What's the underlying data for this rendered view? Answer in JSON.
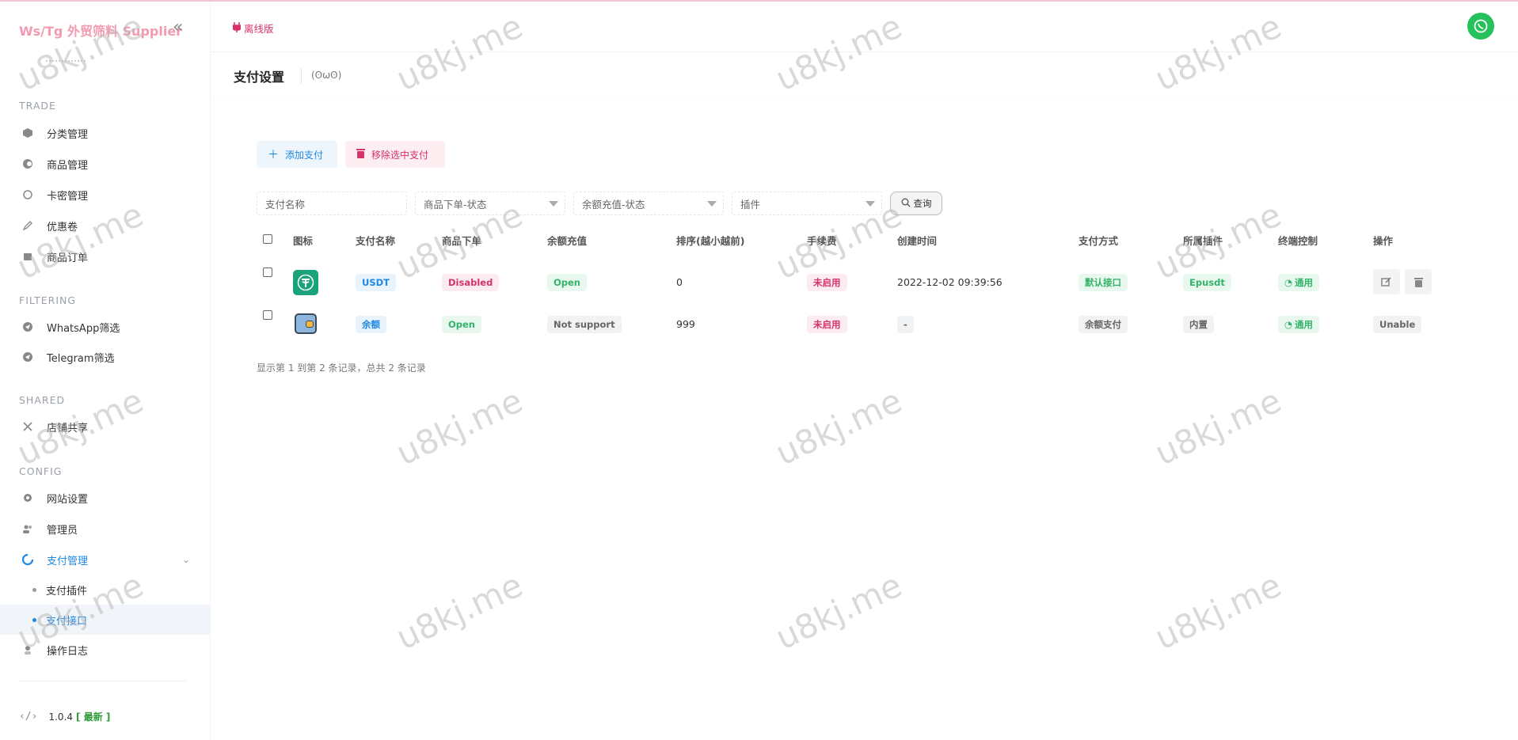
{
  "brand": {
    "title": "Ws/Tg 外贸筛料 Supplier"
  },
  "sidebar": {
    "sections": {
      "trade": "TRADE",
      "filtering": "FILTERING",
      "shared": "SHARED",
      "config": "CONFIG"
    },
    "trade_items": [
      "分类管理",
      "商品管理",
      "卡密管理",
      "优惠卷",
      "商品订单"
    ],
    "filtering_items": [
      "WhatsApp筛选",
      "Telegram筛选"
    ],
    "shared_items": [
      "店铺共享"
    ],
    "config_items": [
      "网站设置",
      "管理员",
      "支付管理"
    ],
    "payment_sub": [
      "支付插件",
      "支付接口"
    ],
    "log_item": "操作日志",
    "version": "1.0.4",
    "latest": "[ 最新 ]"
  },
  "header": {
    "offline": "离线版"
  },
  "page": {
    "title": "支付设置",
    "subtitle": "(ʘωʘ)"
  },
  "toolbar": {
    "add": "添加支付",
    "remove": "移除选中支付"
  },
  "filters": {
    "name_placeholder": "支付名称",
    "order_status": "商品下单-状态",
    "recharge_status": "余额充值-状态",
    "plugin": "插件",
    "search": "查询"
  },
  "table": {
    "headers": [
      "图标",
      "支付名称",
      "商品下单",
      "余额充值",
      "排序(越小越前)",
      "手续费",
      "创建时间",
      "支付方式",
      "所属插件",
      "终端控制",
      "操作"
    ],
    "rows": [
      {
        "name": "USDT",
        "order": "Disabled",
        "recharge": "Open",
        "sort": "0",
        "fee": "未启用",
        "created": "2022-12-02 09:39:56",
        "method": "默认接口",
        "plugin": "Epusdt",
        "terminal": "通用",
        "op": ""
      },
      {
        "name": "余额",
        "order": "Open",
        "recharge": "Not support",
        "sort": "999",
        "fee": "未启用",
        "created": "-",
        "method": "余额支付",
        "plugin": "内置",
        "terminal": "通用",
        "op": "Unable"
      }
    ],
    "footer": "显示第 1 到第 2 条记录，总共 2 条记录"
  },
  "watermark": "u8kj.me"
}
